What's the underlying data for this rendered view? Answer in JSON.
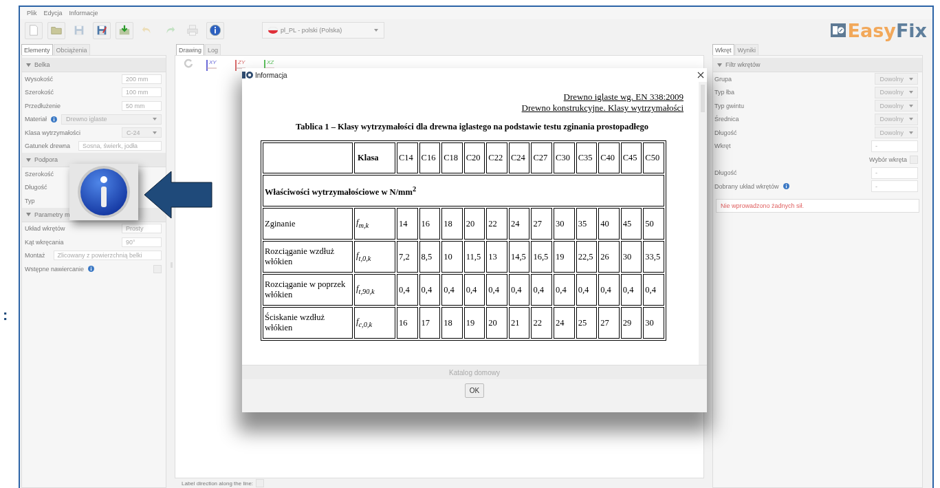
{
  "margin_mark": ":",
  "menu": [
    {
      "label": "Plik"
    },
    {
      "label": "Edycja"
    },
    {
      "label": "Informacje"
    }
  ],
  "toolbar": [
    {
      "kind": "new",
      "disabled": false
    },
    {
      "kind": "open",
      "disabled": false
    },
    {
      "kind": "save",
      "disabled": true
    },
    {
      "kind": "save-as",
      "disabled": false
    },
    {
      "kind": "export",
      "disabled": false
    },
    {
      "kind": "undo",
      "disabled": true
    },
    {
      "kind": "redo",
      "disabled": true
    },
    {
      "kind": "print",
      "disabled": true
    },
    {
      "kind": "info",
      "disabled": false
    }
  ],
  "language": {
    "value": "pl_PL - polski (Polska)"
  },
  "logo": {
    "words": [
      "Easy",
      "Fix"
    ]
  },
  "left_panel": {
    "tabs": [
      {
        "label": "Elementy",
        "selected": true
      },
      {
        "label": "Obciążenia",
        "selected": false
      }
    ],
    "sections": [
      {
        "title": "Belka",
        "expanded": true,
        "rows": [
          {
            "label": "Wysokość",
            "kind": "input",
            "value": "200 mm"
          },
          {
            "label": "Szerokość",
            "kind": "input",
            "value": "100 mm"
          },
          {
            "label": "Przedłużenie",
            "kind": "input",
            "value": "50 mm"
          },
          {
            "label": "Materiał",
            "info": true,
            "kind": "wide-select",
            "value": "Drewno iglaste"
          },
          {
            "label": "Klasa wytrzymałości",
            "kind": "select",
            "value": "C-24"
          },
          {
            "label": "Gatunek drewna",
            "kind": "wide-input",
            "value": "Sosna, świerk, jodła"
          }
        ]
      },
      {
        "title": "Podpora",
        "expanded": true,
        "rows": [
          {
            "label": "Szerokość",
            "kind": "label"
          },
          {
            "label": "Długość",
            "kind": "label"
          },
          {
            "label": "Typ",
            "kind": "label"
          }
        ]
      },
      {
        "title": "Parametry m",
        "expanded": true,
        "rows": [
          {
            "label": "Układ wkrętów",
            "kind": "input",
            "value": "Prosty"
          },
          {
            "label": "Kąt wkręcania",
            "kind": "input",
            "value": "90°"
          },
          {
            "label": "Montaż",
            "kind": "wide-input",
            "value": "Zlicowany z powierzchnią belki"
          },
          {
            "label": "Wstępne nawiercanie",
            "info": true,
            "kind": "checkbox",
            "checked": false
          }
        ]
      }
    ]
  },
  "center": {
    "tabs": [
      {
        "label": "Drawing",
        "selected": true
      },
      {
        "label": "Log",
        "selected": false
      }
    ],
    "views": [
      {
        "label": "XY",
        "color": "#6a6ad8"
      },
      {
        "label": "ZY",
        "color": "#d86a6a"
      },
      {
        "label": "XZ",
        "color": "#5cbf5c"
      }
    ],
    "label_direction": {
      "label": "Label direction along the line:",
      "checked": false
    }
  },
  "dialog": {
    "title": "Informacja",
    "heading": [
      "Drewno iglaste wg. EN 338:2009",
      "Drewno konstrukcyjne. Klasy wytrzymałości"
    ],
    "table_title": "Tablica 1 – Klasy wytrzymałości dla drewna iglastego na podstawie testu zginania prostopadłego",
    "table": [
      {
        "kind": "header",
        "symbol": "Klasa",
        "values": [
          "C14",
          "C16",
          "C18",
          "C20",
          "C22",
          "C24",
          "C27",
          "C30",
          "C35",
          "C40",
          "C45",
          "C50"
        ]
      },
      {
        "kind": "section",
        "label": "Właściwości wytrzymałościowe w N/mm$^{2}$"
      },
      {
        "kind": "data",
        "label": "Zginanie",
        "symbol": "f$_{m,k}$",
        "values": [
          "14",
          "16",
          "18",
          "20",
          "22",
          "24",
          "27",
          "30",
          "35",
          "40",
          "45",
          "50"
        ]
      },
      {
        "kind": "data",
        "label": "Rozciąganie wzdłuż włókien",
        "symbol": "f$_{t,0,k}$",
        "values": [
          "7,2",
          "8,5",
          "10",
          "11,5",
          "13",
          "14,5",
          "16,5",
          "19",
          "22,5",
          "26",
          "30",
          "33,5"
        ]
      },
      {
        "kind": "data",
        "label": "Rozciąganie w poprzek włókien",
        "symbol": "f$_{t,90,k}$",
        "values": [
          "0,4",
          "0,4",
          "0,4",
          "0,4",
          "0,4",
          "0,4",
          "0,4",
          "0,4",
          "0,4",
          "0,4",
          "0,4",
          "0,4"
        ]
      },
      {
        "kind": "data",
        "label": "Ściskanie wzdłuż włókien",
        "symbol": "f$_{c,0,k}$",
        "values": [
          "16",
          "17",
          "18",
          "19",
          "20",
          "21",
          "22",
          "24",
          "25",
          "27",
          "29",
          "30"
        ]
      }
    ],
    "footer": "Katalog domowy",
    "button": "OK"
  },
  "right_panel": {
    "tabs": [
      {
        "label": "Wkręt",
        "selected": true
      },
      {
        "label": "Wyniki",
        "selected": false
      }
    ],
    "section": {
      "title": "Filtr wkrętów",
      "expanded": true
    },
    "rows": [
      {
        "label": "Grupa",
        "kind": "select",
        "value": "Dowolny"
      },
      {
        "label": "Typ łba",
        "kind": "select",
        "value": "Dowolny"
      },
      {
        "label": "Typ gwintu",
        "kind": "select",
        "value": "Dowolny"
      },
      {
        "label": "Średnica",
        "kind": "select",
        "value": "Dowolny"
      },
      {
        "label": "Długość",
        "kind": "select",
        "value": "Dowolny"
      },
      {
        "label": "Wkręt",
        "kind": "input",
        "value": "-",
        "option": {
          "label": "Wybór wkręta",
          "checked": false
        }
      },
      {
        "label": "Długość",
        "kind": "input",
        "value": "-"
      },
      {
        "label": "Dobrany układ wkrętów",
        "info": true,
        "kind": "input",
        "value": "-"
      }
    ],
    "message": "Nie wprowadzono żadnych sił."
  }
}
